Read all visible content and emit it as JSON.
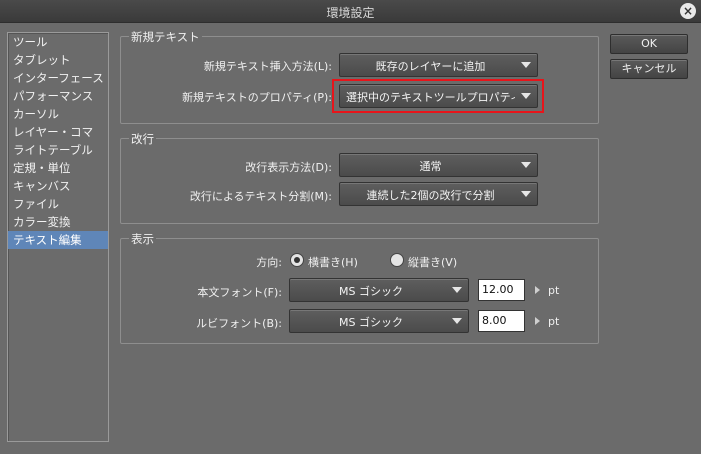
{
  "window": {
    "title": "環境設定",
    "close_glyph": "×"
  },
  "sidebar": {
    "items": [
      {
        "label": "ツール"
      },
      {
        "label": "タブレット"
      },
      {
        "label": "インターフェース"
      },
      {
        "label": "パフォーマンス"
      },
      {
        "label": "カーソル"
      },
      {
        "label": "レイヤー・コマ"
      },
      {
        "label": "ライトテーブル"
      },
      {
        "label": "定規・単位"
      },
      {
        "label": "キャンバス"
      },
      {
        "label": "ファイル"
      },
      {
        "label": "カラー変換"
      },
      {
        "label": "テキスト編集"
      }
    ],
    "selected": "テキスト編集"
  },
  "buttons": {
    "ok": "OK",
    "cancel": "キャンセル"
  },
  "new_text": {
    "title": "新規テキスト",
    "insert_method_label": "新規テキスト挿入方法(L):",
    "insert_method_value": "既存のレイヤーに追加",
    "property_label": "新規テキストのプロパティ(P):",
    "property_value": "選択中のテキストツールプロパティ"
  },
  "line_break": {
    "title": "改行",
    "display_label": "改行表示方法(D):",
    "display_value": "通常",
    "split_label": "改行によるテキスト分割(M):",
    "split_value": "連続した2個の改行で分割"
  },
  "display": {
    "title": "表示",
    "direction_label": "方向:",
    "horizontal_label": "横書き(H)",
    "vertical_label": "縦書き(V)",
    "horizontal_selected": true,
    "body_font_label": "本文フォント(F):",
    "body_font_value": "MS ゴシック",
    "body_font_size": "12.00",
    "ruby_font_label": "ルビフォント(B):",
    "ruby_font_value": "MS ゴシック",
    "ruby_font_size": "8.00",
    "unit": "pt"
  },
  "colors": {
    "highlight": "#e8141a",
    "selected_bg": "#5f86b8",
    "panel_bg": "#6b6b6b"
  }
}
